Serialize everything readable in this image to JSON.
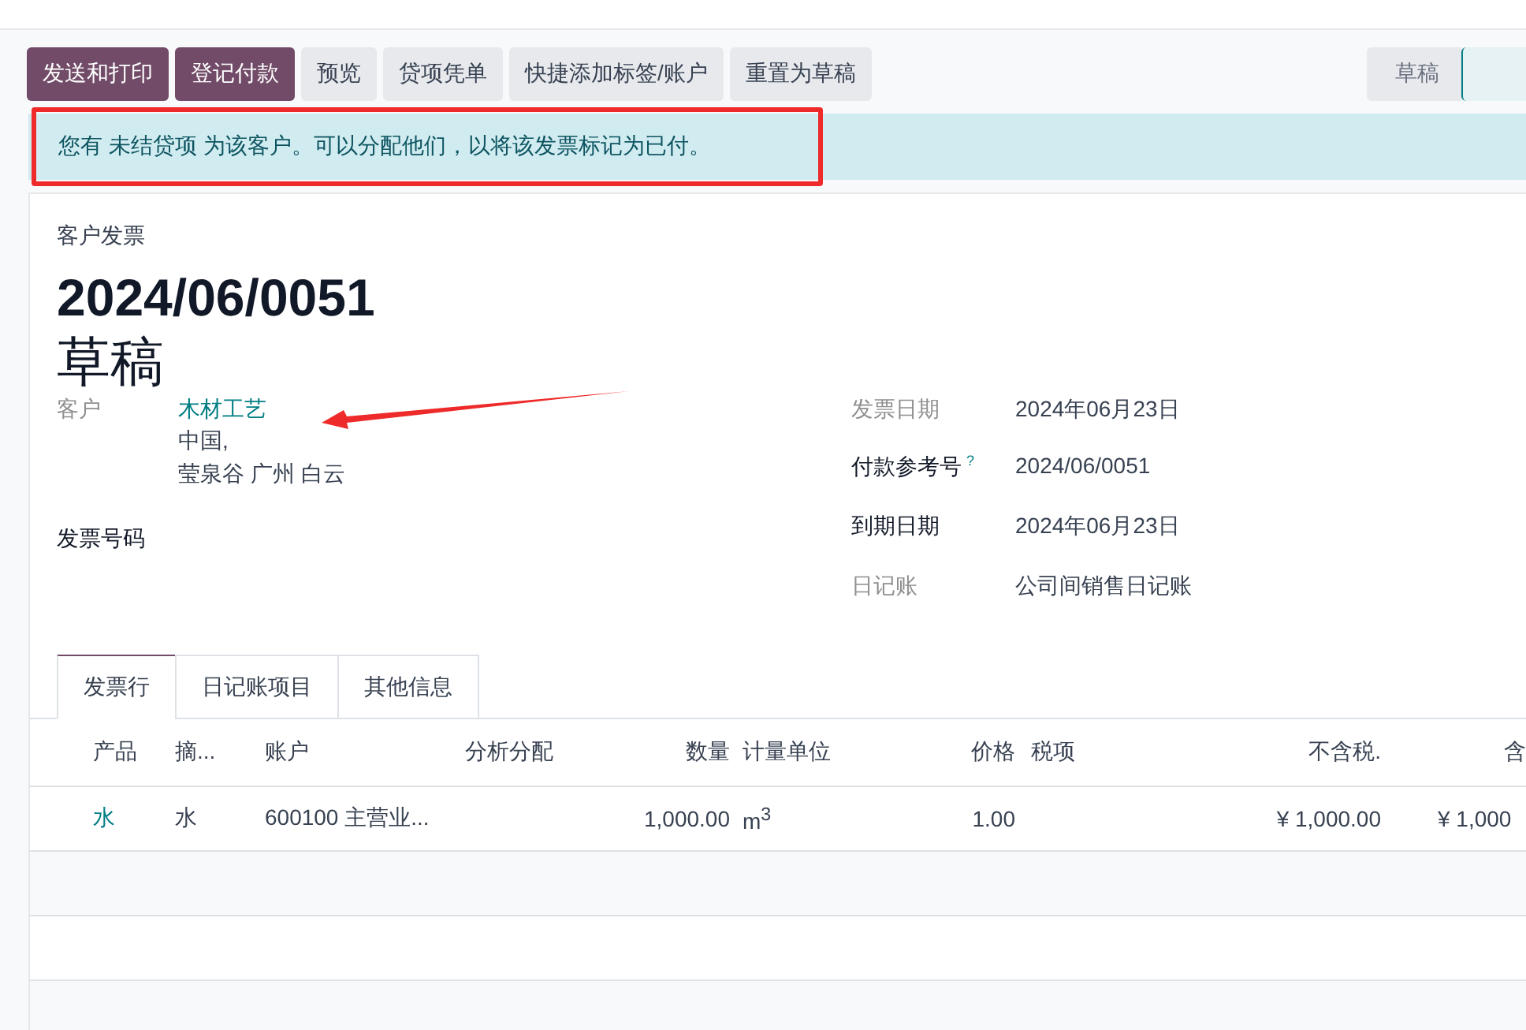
{
  "action_buttons": [
    {
      "label": "发送和打印",
      "kind": "primary"
    },
    {
      "label": "登记付款",
      "kind": "primary"
    },
    {
      "label": "预览",
      "kind": "secondary"
    },
    {
      "label": "贷项凭单",
      "kind": "secondary"
    },
    {
      "label": "快捷添加标签/账户",
      "kind": "secondary"
    },
    {
      "label": "重置为草稿",
      "kind": "secondary"
    }
  ],
  "status_steps": [
    {
      "label": "草稿",
      "selected": false
    },
    {
      "selected": true
    }
  ],
  "alert": {
    "text": "您有 未结贷项 为该客户。可以分配他们，以将该发票标记为已付。",
    "highlighted": true
  },
  "invoice": {
    "type_label": "客户发票",
    "number": "2024/06/0051",
    "state": "草稿"
  },
  "left_fields": [
    {
      "label": "客户",
      "value": "木材工艺",
      "address": [
        "中国,",
        "莹泉谷 广州 白云"
      ],
      "link": true,
      "annotated": true
    },
    {
      "label": "发票号码",
      "bold": true
    }
  ],
  "right_fields": [
    {
      "label": "发票日期",
      "value": "2024年06月23日",
      "bold": false
    },
    {
      "label": "付款参考号",
      "hint": "?",
      "value": "2024/06/0051",
      "bold": true
    },
    {
      "label": "到期日期",
      "value": "2024年06月23日",
      "bold": true
    },
    {
      "label": "日记账",
      "value": "公司间销售日记账",
      "bold": false
    }
  ],
  "tabs": [
    {
      "label": "发票行",
      "selected": true
    },
    {
      "label": "日记账项目",
      "selected": false
    },
    {
      "label": "其他信息",
      "selected": false
    }
  ],
  "table": {
    "columns": [
      "产品",
      "摘...",
      "账户",
      "分析分配",
      "数量",
      "计量单位",
      "价格",
      "税项",
      "不含税.",
      "含"
    ],
    "rows": [
      {
        "cells": [
          "水",
          "水",
          "600100 主营业...",
          "",
          "1,000.00",
          "m$^{3}$",
          "1.00",
          "",
          "¥ 1,000.00",
          "¥ 1,000"
        ]
      }
    ]
  }
}
